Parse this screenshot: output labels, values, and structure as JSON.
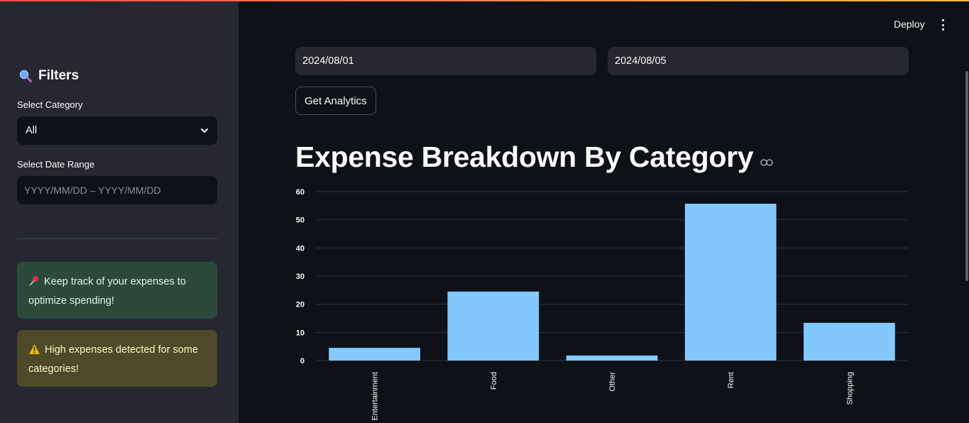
{
  "sidebar": {
    "filters_title": "Filters",
    "category_label": "Select Category",
    "category_value": "All",
    "date_range_label": "Select Date Range",
    "date_range_placeholder": "YYYY/MM/DD – YYYY/MM/DD",
    "info_message": "Keep track of your expenses to optimize spending!",
    "warning_message": "High expenses detected for some categories!"
  },
  "header": {
    "deploy_label": "Deploy"
  },
  "main": {
    "start_date": "2024/08/01",
    "end_date": "2024/08/05",
    "button_label": "Get Analytics",
    "heading": "Expense Breakdown By Category"
  },
  "colors": {
    "bar": "#83c9ff",
    "grid": "#31333f",
    "axis_text": "#fafafa"
  },
  "chart_data": {
    "type": "bar",
    "categories": [
      "Entertainment",
      "Food",
      "Other",
      "Rent",
      "Shopping"
    ],
    "values": [
      4.5,
      24.5,
      1.8,
      55.7,
      13.4
    ],
    "title": "",
    "xlabel": "",
    "ylabel": "",
    "ylim": [
      0,
      60
    ],
    "yticks": [
      0,
      10,
      20,
      30,
      40,
      50,
      60
    ],
    "grid": true
  }
}
